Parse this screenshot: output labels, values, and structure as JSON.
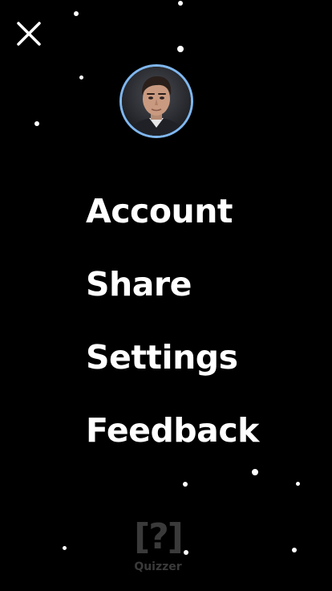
{
  "header": {
    "close_icon": "close-icon"
  },
  "profile": {
    "avatar": "avatar-photo"
  },
  "menu": {
    "items": [
      {
        "label": "Account"
      },
      {
        "label": "Share"
      },
      {
        "label": "Settings"
      },
      {
        "label": "Feedback"
      }
    ]
  },
  "brand": {
    "mark": "[?]",
    "name": "Quizzer"
  },
  "colors": {
    "background": "#000000",
    "text": "#ffffff",
    "avatar_ring": "#7fb7ef",
    "logo": "#3a3a3a"
  }
}
